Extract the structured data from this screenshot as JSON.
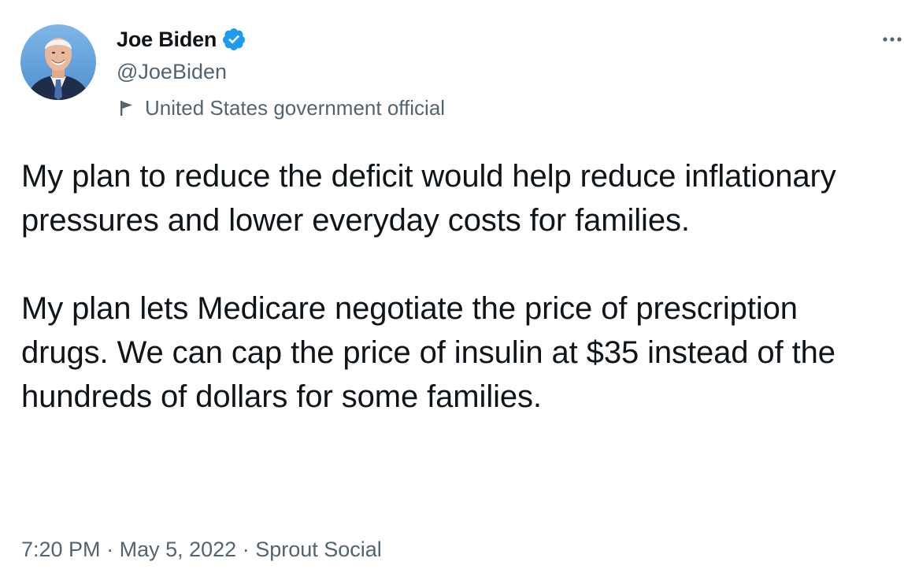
{
  "author": {
    "display_name": "Joe Biden",
    "handle": "@JoeBiden",
    "avatar_icon": "joe-biden-portrait",
    "verified_icon": "verified-badge-icon",
    "label_icon": "flag-icon",
    "label": "United States government official"
  },
  "tweet": {
    "paragraphs": [
      "My plan to reduce the deficit would help reduce inflationary pressures and lower everyday costs for families.",
      "My plan lets Medicare negotiate the price of prescription drugs. We can cap the price of insulin at $35 instead of the hundreds of dollars for some families."
    ]
  },
  "meta": {
    "time": "7:20 PM",
    "separator": "·",
    "date": "May 5, 2022",
    "source": "Sprout Social"
  },
  "colors": {
    "text_primary": "#0f1419",
    "text_secondary": "#536471",
    "verified_blue": "#1d9bf0"
  }
}
